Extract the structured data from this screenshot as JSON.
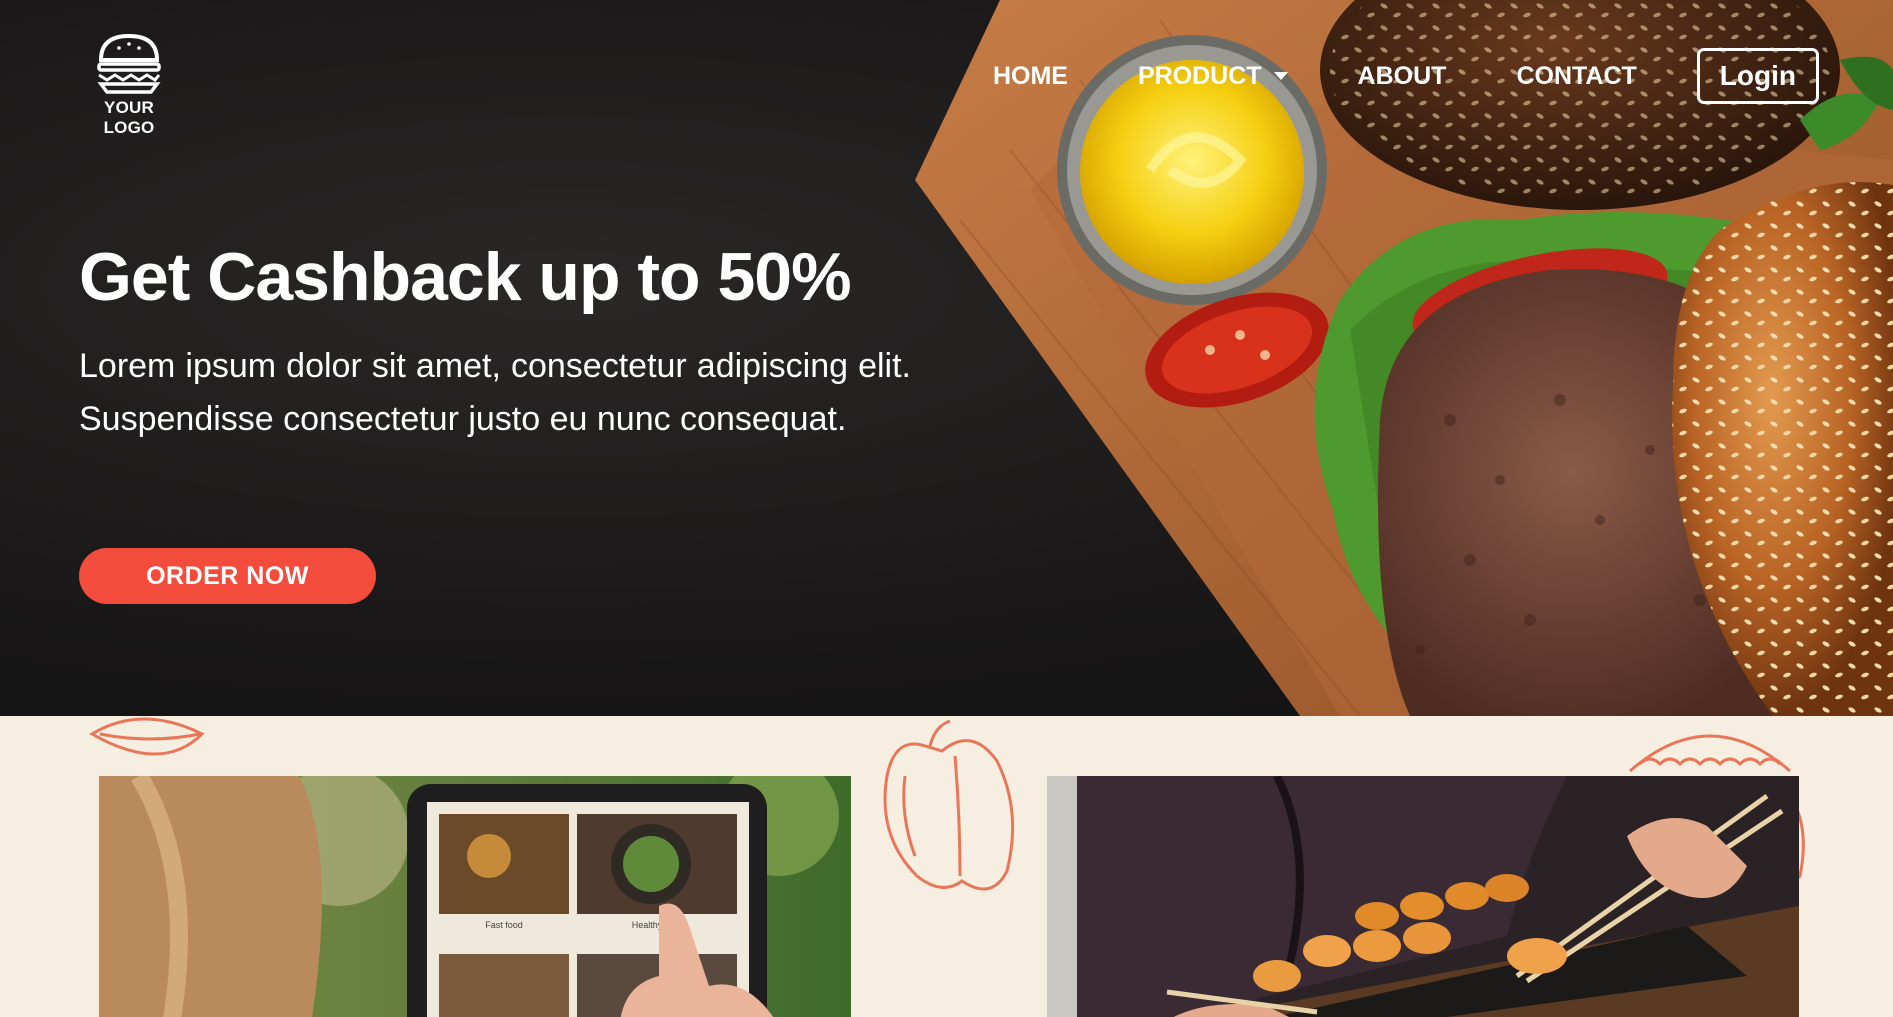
{
  "header": {
    "logo_text": "YOUR LOGO",
    "logo_icon": "burger-icon",
    "nav": [
      {
        "label": "HOME"
      },
      {
        "label": "PRODUCT",
        "has_dropdown": true
      },
      {
        "label": "ABOUT"
      },
      {
        "label": "CONTACT"
      }
    ],
    "login_label": "Login"
  },
  "hero": {
    "title": "Get Cashback up to 50%",
    "description": "Lorem ipsum dolor sit amet, consectetur adipiscing elit. Suspendisse consectetur justo eu nunc consequat.",
    "cta_label": "ORDER NOW"
  },
  "cards": [
    {
      "tablet_labels": [
        "Fast food",
        "Healthy food"
      ]
    },
    {}
  ],
  "colors": {
    "accent": "#f44c3c",
    "hero_bg": "#1a1818",
    "section_bg": "#f6eee0",
    "doodle": "#e8775a"
  }
}
